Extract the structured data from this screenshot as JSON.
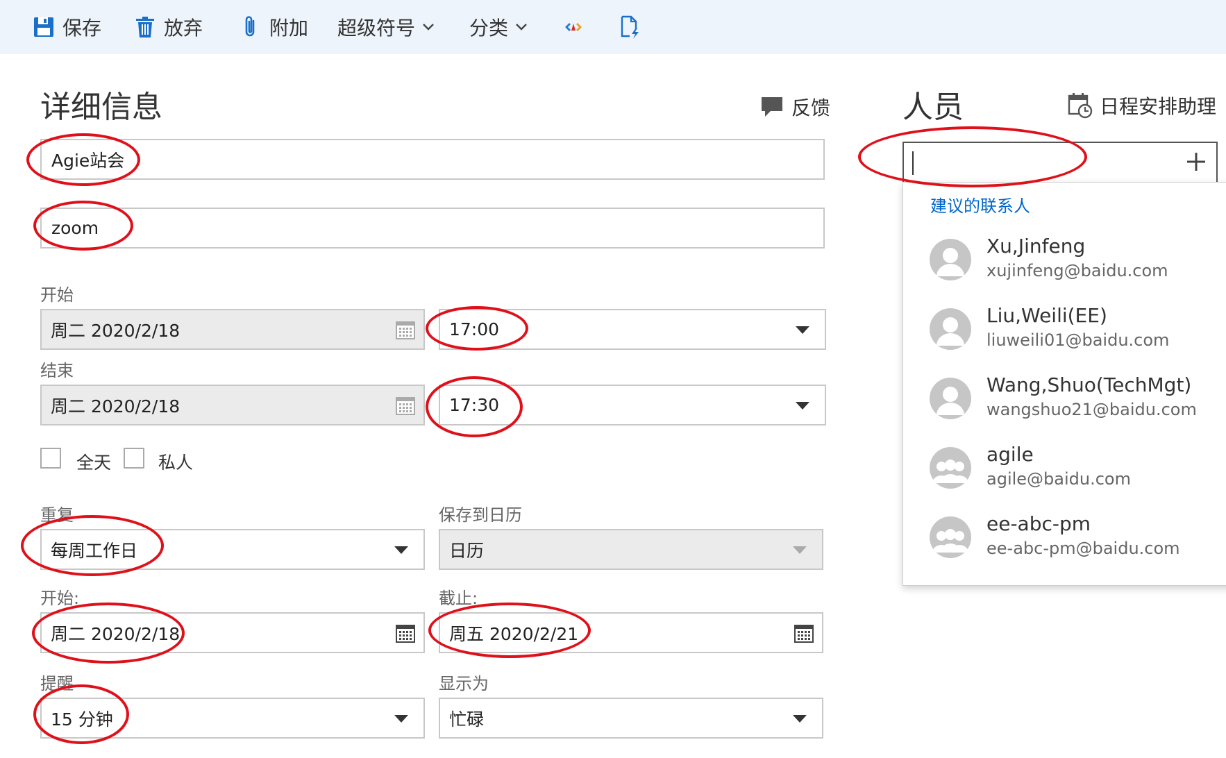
{
  "toolbar": {
    "save": "保存",
    "discard": "放弃",
    "attach": "附加",
    "superscript": "超级符号",
    "category": "分类"
  },
  "details": {
    "title": "详细信息",
    "feedback": "反馈",
    "subject": "Agie站会",
    "location": "zoom",
    "start_label": "开始",
    "start_date": "周二 2020/2/18",
    "start_time": "17:00",
    "end_label": "结束",
    "end_date": "周二 2020/2/18",
    "end_time": "17:30",
    "all_day": "全天",
    "private": "私人",
    "repeat_label": "重复",
    "repeat_value": "每周工作日",
    "save_to_label": "保存到日历",
    "save_to_value": "日历",
    "repeat_start_label": "开始:",
    "repeat_start_value": "周二 2020/2/18",
    "repeat_end_label": "截止:",
    "repeat_end_value": "周五 2020/2/21",
    "reminder_label": "提醒",
    "reminder_value": "15 分钟",
    "show_as_label": "显示为",
    "show_as_value": "忙碌"
  },
  "people": {
    "title": "人员",
    "scheduling_assistant": "日程安排助理",
    "search_value": "",
    "suggested_header": "建议的联系人",
    "contacts": [
      {
        "name": "Xu,Jinfeng",
        "email": "xujinfeng@baidu.com",
        "type": "person-icon"
      },
      {
        "name": "Liu,Weili(EE)",
        "email": "liuweili01@baidu.com",
        "type": "person-icon"
      },
      {
        "name": "Wang,Shuo(TechMgt)",
        "email": "wangshuo21@baidu.com",
        "type": "person-icon"
      },
      {
        "name": "agile",
        "email": "agile@baidu.com",
        "type": "group-icon"
      },
      {
        "name": "ee-abc-pm",
        "email": "ee-abc-pm@baidu.com",
        "type": "group-icon"
      }
    ]
  },
  "colors": {
    "accent": "#0066cc",
    "annotation_red": "#e0101a",
    "toolbar_bg": "#eef4fb"
  }
}
